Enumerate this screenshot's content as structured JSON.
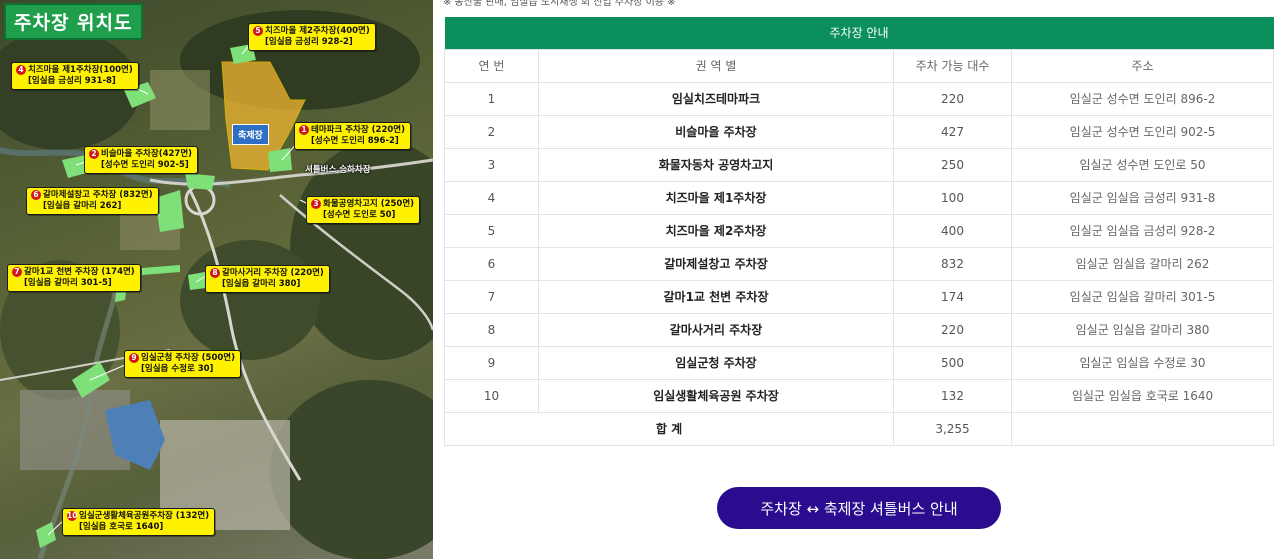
{
  "note": "※ 농산물 판매, 임실읍 도시재생 회 진입 주차장 이용 ※",
  "map": {
    "title": "주차장 위치도",
    "festival_label": "축제장",
    "shuttle_stop_label": "셔틀버스 승하차장",
    "labels": [
      {
        "num": "1",
        "line1": "테마파크 주차장 (220면)",
        "line2": "[성수면 도인리 896-2]"
      },
      {
        "num": "2",
        "line1": "비슬마을 주차장(427면)",
        "line2": "[성수면 도인리 902-5]"
      },
      {
        "num": "3",
        "line1": "화물공영차고지 (250면)",
        "line2": "[성수면 도인로 50]"
      },
      {
        "num": "4",
        "line1": "치즈마을 제1주차장(100면)",
        "line2": "[임실읍 금성리 931-8]"
      },
      {
        "num": "5",
        "line1": "치즈마을 제2주차장(400면)",
        "line2": "[임실읍 금성리 928-2]"
      },
      {
        "num": "6",
        "line1": "갈마제설창고 주차장 (832면)",
        "line2": "[임실읍 갈마리 262]"
      },
      {
        "num": "7",
        "line1": "갈마1교 천변 주차장 (174면)",
        "line2": "[임실읍 갈마리 301-5]"
      },
      {
        "num": "8",
        "line1": "갈마사거리 주차장 (220면)",
        "line2": "[임실읍 갈마리 380]"
      },
      {
        "num": "9",
        "line1": "임실군청 주차장 (500면)",
        "line2": "[임실읍 수정로 30]"
      },
      {
        "num": "10",
        "line1": "임실군생활체육공원주차장 (132면)",
        "line2": "[임실읍 호국로 1640]"
      }
    ]
  },
  "table": {
    "caption": "주차장 안내",
    "headers": [
      "연 번",
      "권 역 별",
      "주차 가능 대수",
      "주소"
    ],
    "rows": [
      {
        "no": "1",
        "name": "임실치즈테마파크",
        "count": "220",
        "addr": "임실군 성수면 도인리 896-2"
      },
      {
        "no": "2",
        "name": "비슬마을 주차장",
        "count": "427",
        "addr": "임실군 성수면 도인리 902-5"
      },
      {
        "no": "3",
        "name": "화물자동차 공영차고지",
        "count": "250",
        "addr": "임실군 성수면 도인로 50"
      },
      {
        "no": "4",
        "name": "치즈마을 제1주차장",
        "count": "100",
        "addr": "임실군 임실읍 금성리 931-8"
      },
      {
        "no": "5",
        "name": "치즈마을 제2주차장",
        "count": "400",
        "addr": "임실군 임실읍 금성리 928-2"
      },
      {
        "no": "6",
        "name": "갈마제설창고 주차장",
        "count": "832",
        "addr": "임실군 임실읍 갈마리 262"
      },
      {
        "no": "7",
        "name": "갈마1교 천변 주차장",
        "count": "174",
        "addr": "임실군 임실읍 갈마리 301-5"
      },
      {
        "no": "8",
        "name": "갈마사거리 주차장",
        "count": "220",
        "addr": "임실군 임실읍 갈마리 380"
      },
      {
        "no": "9",
        "name": "임실군청 주차장",
        "count": "500",
        "addr": "임실군 임실읍 수정로 30"
      },
      {
        "no": "10",
        "name": "임실생활체육공원 주차장",
        "count": "132",
        "addr": "임실군 임실읍 호국로 1640"
      }
    ],
    "total_label": "합 계",
    "total_count": "3,255"
  },
  "shuttle_button": "주차장 ↔ 축제장 셔틀버스 안내",
  "colors": {
    "table_header": "#0a8f5d",
    "button": "#2a0c8e",
    "map_title_bg": "#1f9e4c",
    "label_bg": "#fff200",
    "parking_area": "#7fe07a"
  }
}
